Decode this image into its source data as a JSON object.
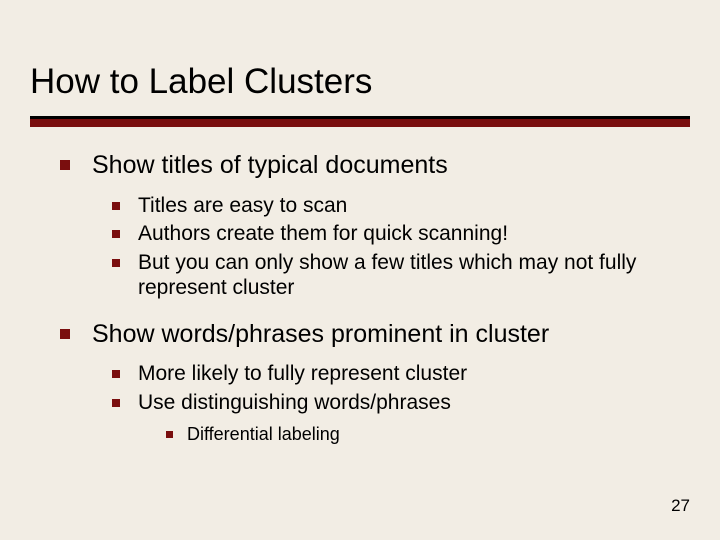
{
  "title": "How to Label Clusters",
  "bullets": {
    "a": {
      "text": "Show titles of typical documents",
      "sub": [
        "Titles are easy to scan",
        "Authors create them for quick scanning!",
        "But you can only show a few titles which may not fully represent cluster"
      ]
    },
    "b": {
      "text": "Show words/phrases prominent in cluster",
      "sub": [
        "More likely to fully represent cluster",
        "Use distinguishing words/phrases"
      ],
      "subsub": [
        "Differential labeling"
      ]
    }
  },
  "page_number": "27"
}
